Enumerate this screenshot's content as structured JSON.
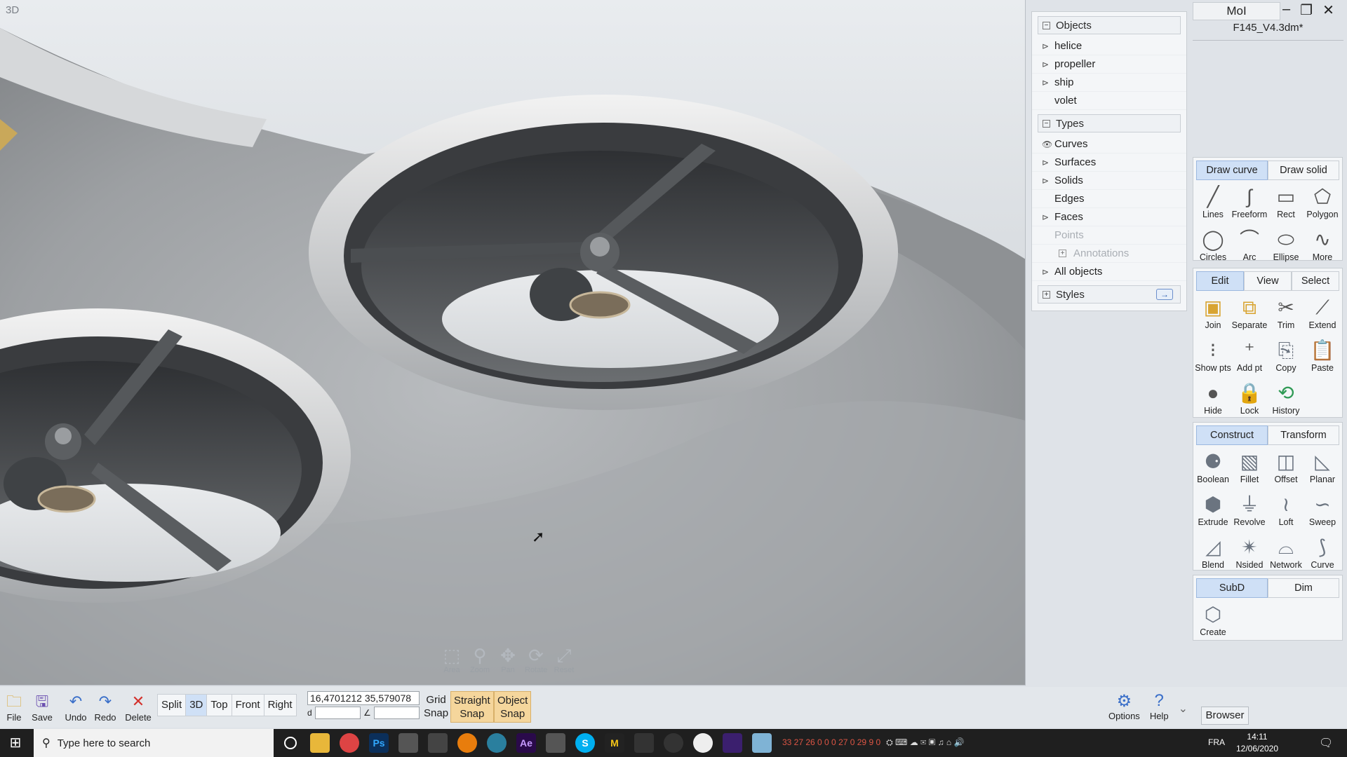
{
  "viewport": {
    "label": "3D",
    "nav_tools": [
      {
        "label": "Area",
        "icon": "area-icon"
      },
      {
        "label": "Zoom",
        "icon": "zoom-icon"
      },
      {
        "label": "Pan",
        "icon": "pan-icon"
      },
      {
        "label": "Rotate",
        "icon": "rotate-icon"
      },
      {
        "label": "Reset",
        "icon": "reset-icon"
      }
    ]
  },
  "scene_panel": {
    "objects_header": "Objects",
    "objects": [
      "helice",
      "propeller",
      "ship",
      "volet"
    ],
    "types_header": "Types",
    "types": [
      "Curves",
      "Surfaces",
      "Solids",
      "Edges",
      "Faces",
      "Points",
      "Annotations"
    ],
    "all_objects": "All objects",
    "styles": "Styles"
  },
  "app": {
    "title": "MoI",
    "file_name": "F145_V4.3dm*"
  },
  "palettes": {
    "draw": {
      "tabs": [
        "Draw curve",
        "Draw solid"
      ],
      "tools": [
        "Lines",
        "Freeform",
        "Rect",
        "Polygon",
        "Circles",
        "Arc",
        "Ellipse",
        "More"
      ]
    },
    "edit": {
      "tabs": [
        "Edit",
        "View",
        "Select"
      ],
      "tools": [
        "Join",
        "Separate",
        "Trim",
        "Extend",
        "Show pts",
        "Add pt",
        "Copy",
        "Paste",
        "Hide",
        "Lock",
        "History"
      ]
    },
    "construct": {
      "tabs": [
        "Construct",
        "Transform"
      ],
      "tools": [
        "Boolean",
        "Fillet",
        "Offset",
        "Planar",
        "Extrude",
        "Revolve",
        "Loft",
        "Sweep",
        "Blend",
        "Nsided",
        "Network",
        "Curve"
      ]
    },
    "subd": {
      "tabs": [
        "SubD",
        "Dim"
      ],
      "tools": [
        "Create"
      ]
    }
  },
  "bottom_bar": {
    "file": "File",
    "save": "Save",
    "undo": "Undo",
    "redo": "Redo",
    "delete": "Delete",
    "views": [
      "Split",
      "3D",
      "Top",
      "Front",
      "Right"
    ],
    "coord": "16,4701212  35,579078",
    "coord_d": "d",
    "coord_angle": "∠",
    "grid_snap": [
      "Grid",
      "Snap"
    ],
    "straight_snap": [
      "Straight",
      "Snap"
    ],
    "object_snap": [
      "Object",
      "Snap"
    ],
    "options": "Options",
    "help": "Help",
    "browser": "Browser"
  },
  "taskbar": {
    "search_placeholder": "Type here to search",
    "tray_numbers": "33 27 26 0 0 0 27 0 29 9 0",
    "language": "FRA",
    "time": "14:11",
    "date": "12/06/2020"
  },
  "colors": {
    "tab_active": "#cfe0f6",
    "snap_on": "#f5d69c",
    "accent_blue": "#3a6fc9"
  }
}
